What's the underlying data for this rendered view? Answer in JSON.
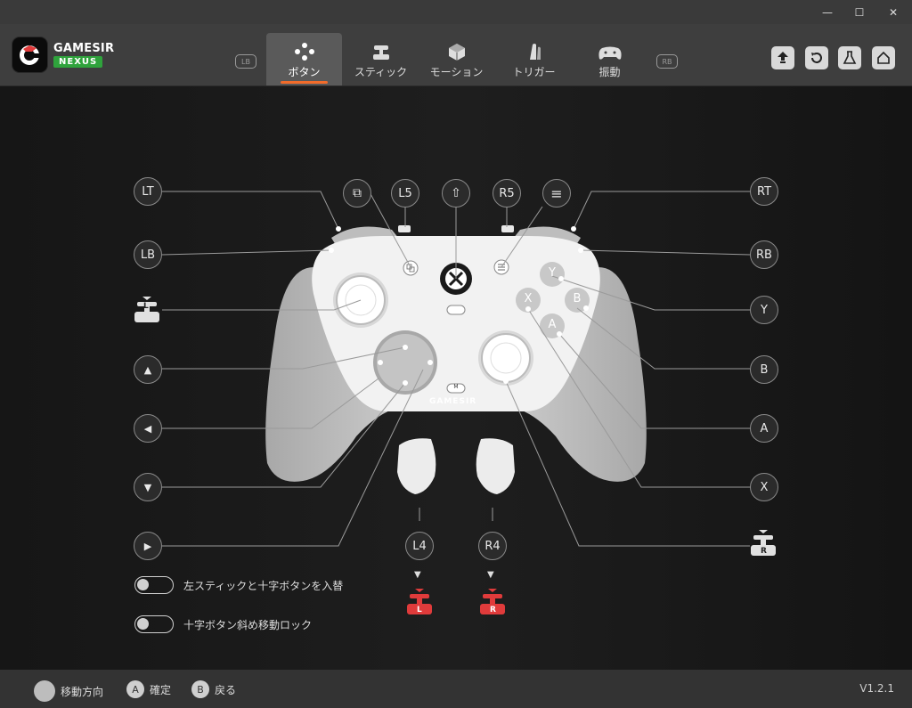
{
  "window": {
    "minimize": "—",
    "maximize": "☐",
    "close": "✕"
  },
  "brand": {
    "name": "GAMESIR",
    "sub": "NEXUS"
  },
  "nav": {
    "lb": "LB",
    "rb": "RB",
    "tabs": [
      {
        "label": "ボタン",
        "icon": "dpad-dots-icon",
        "active": true
      },
      {
        "label": "スティック",
        "icon": "stick-icon",
        "active": false
      },
      {
        "label": "モーション",
        "icon": "cube-icon",
        "active": false
      },
      {
        "label": "トリガー",
        "icon": "trigger-icon",
        "active": false
      },
      {
        "label": "振動",
        "icon": "gamepad-icon",
        "active": false
      }
    ]
  },
  "header_buttons": [
    "upgrade-icon",
    "reset-icon",
    "lab-icon",
    "home-icon"
  ],
  "left_buttons": {
    "lt": "LT",
    "lb": "LB",
    "up": "▲",
    "left": "◀",
    "down": "▼",
    "right": "▶"
  },
  "top_buttons": {
    "view": "⧉",
    "l5": "L5",
    "share": "⇧",
    "r5": "R5",
    "menu": "≡"
  },
  "right_buttons": {
    "rt": "RT",
    "rb": "RB",
    "y": "Y",
    "b": "B",
    "a": "A",
    "x": "X"
  },
  "back_buttons": {
    "l4": "L4",
    "r4": "R4"
  },
  "stick_icons": {
    "left": "L",
    "right": "R"
  },
  "controller": {
    "brand": "GAMESIR",
    "m_button": "M",
    "face": {
      "y": "Y",
      "x": "X",
      "b": "B",
      "a": "A"
    }
  },
  "toggles": [
    {
      "label": "左スティックと十字ボタンを入替",
      "on": false
    },
    {
      "label": "十字ボタン斜め移動ロック",
      "on": false
    }
  ],
  "footer": {
    "move_label": "移動方向",
    "confirm_btn": "A",
    "confirm_label": "確定",
    "back_btn": "B",
    "back_label": "戻る",
    "version": "V1.2.1"
  },
  "colors": {
    "accent": "#f26c2b",
    "brand_green": "#2fa33c",
    "mapped_red": "#e03b3b"
  }
}
